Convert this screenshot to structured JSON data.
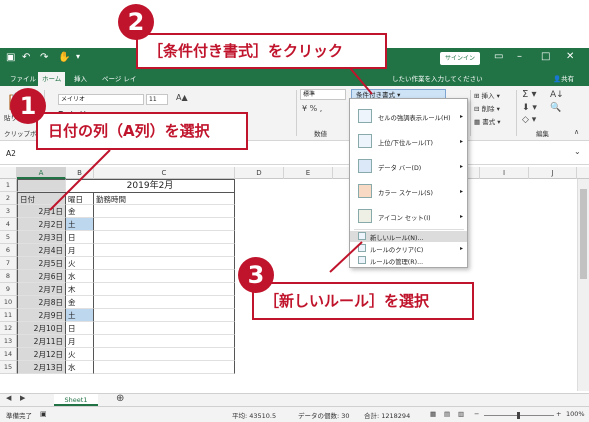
{
  "window": {
    "qat_icons": [
      "save-icon",
      "undo-icon",
      "redo-icon",
      "touch-mode-icon",
      "customize-icon"
    ],
    "signin_label": "サインイン",
    "window_controls": [
      "ribbon-display-icon",
      "minimize-icon",
      "maximize-icon",
      "close-icon"
    ]
  },
  "tabs": [
    {
      "label": "ファイル",
      "active": false
    },
    {
      "label": "ホーム",
      "active": true
    },
    {
      "label": "挿入",
      "active": false
    },
    {
      "label": "ページ レイ",
      "active": false
    }
  ],
  "tellme_text": "したい作業を入力してください",
  "share_label": "共有",
  "ribbon": {
    "paste_label": "貼り付",
    "clipboard_label": "クリップボ",
    "font_name": "メイリオ",
    "font_size": "11",
    "number_format": "標準",
    "number_group_label": "数値",
    "conditional_format_label": "条件付き書式",
    "insert_label": "挿入",
    "delete_label": "削除",
    "format_label": "書式",
    "edit_group_label": "編集"
  },
  "name_box": "A2",
  "columns": [
    "A",
    "B",
    "C",
    "D",
    "E",
    "F",
    "G",
    "H",
    "I",
    "J",
    "K"
  ],
  "sheet": {
    "title": "2019年2月",
    "headers": [
      "日付",
      "曜日",
      "勤務時間"
    ],
    "rows": [
      {
        "num": "3",
        "date": "2月1日",
        "day": "金"
      },
      {
        "num": "4",
        "date": "2月2日",
        "day": "土"
      },
      {
        "num": "5",
        "date": "2月3日",
        "day": "日"
      },
      {
        "num": "6",
        "date": "2月4日",
        "day": "月"
      },
      {
        "num": "7",
        "date": "2月5日",
        "day": "火"
      },
      {
        "num": "8",
        "date": "2月6日",
        "day": "水"
      },
      {
        "num": "9",
        "date": "2月7日",
        "day": "木"
      },
      {
        "num": "10",
        "date": "2月8日",
        "day": "金"
      },
      {
        "num": "11",
        "date": "2月9日",
        "day": "土"
      },
      {
        "num": "12",
        "date": "2月10日",
        "day": "日"
      },
      {
        "num": "13",
        "date": "2月11日",
        "day": "月"
      },
      {
        "num": "14",
        "date": "2月12日",
        "day": "火"
      },
      {
        "num": "15",
        "date": "2月13日",
        "day": "水"
      }
    ]
  },
  "cf_menu": {
    "items": [
      {
        "label": "セルの強調表示ルール(H)",
        "submenu": true
      },
      {
        "label": "上位/下位ルール(T)",
        "submenu": true
      },
      {
        "label": "データ バー(D)",
        "submenu": true
      },
      {
        "label": "カラー スケール(S)",
        "submenu": true
      },
      {
        "label": "アイコン セット(I)",
        "submenu": true
      }
    ],
    "small_items": [
      {
        "label": "新しいルール(N)...",
        "highlighted": true
      },
      {
        "label": "ルールのクリア(C)",
        "submenu": true
      },
      {
        "label": "ルールの管理(R)...",
        "submenu": false
      }
    ]
  },
  "sheet_tab": "Sheet1",
  "status": {
    "ready": "準備完了",
    "average": "平均: 43510.5",
    "count": "データの個数: 30",
    "sum": "合計: 1218294",
    "zoom": "100%"
  },
  "annotations": {
    "step1": {
      "number": "1",
      "text": "日付の列（A列）を選択"
    },
    "step2": {
      "number": "2",
      "text": "［条件付き書式］をクリック"
    },
    "step3": {
      "number": "3",
      "text": "［新しいルール］を選択"
    }
  },
  "colors": {
    "excel_green": "#217346",
    "callout_red": "#c0142c",
    "saturday_blue": "#bdd7ee"
  }
}
